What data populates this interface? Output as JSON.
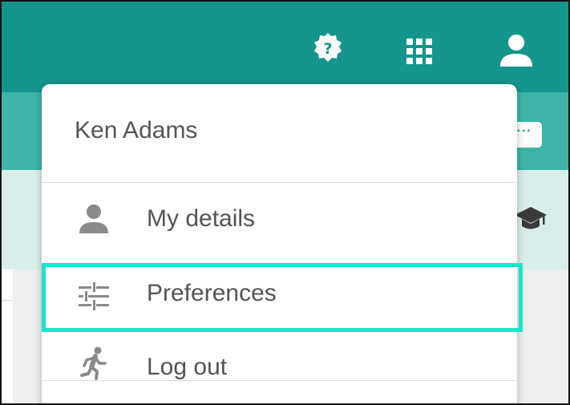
{
  "header": {
    "icons": {
      "help": "help-icon",
      "apps": "apps-grid-icon",
      "account": "account-icon"
    },
    "colors": {
      "topbar": "#15968c",
      "subbar": "#3db4a7",
      "lightband": "#d9eeeb",
      "highlight": "#19e6c8"
    }
  },
  "background": {
    "more_button_label": "···",
    "graduation_icon": "graduation-cap-icon"
  },
  "user_menu": {
    "user_name": "Ken Adams",
    "items": [
      {
        "label": "My details",
        "icon": "person-icon"
      },
      {
        "label": "Preferences",
        "icon": "sliders-icon",
        "highlighted": true
      },
      {
        "label": "Log out",
        "icon": "running-person-icon"
      }
    ]
  }
}
